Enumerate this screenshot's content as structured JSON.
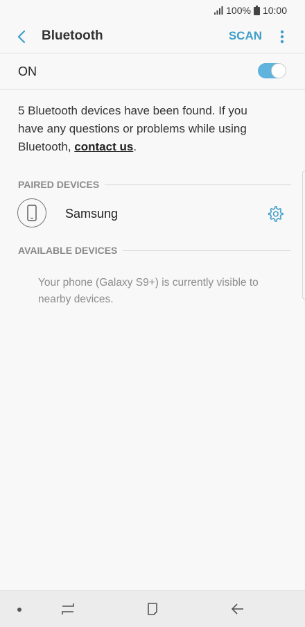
{
  "status_bar": {
    "battery_percent": "100%",
    "time": "10:00",
    "icons": [
      "signal-icon",
      "battery-icon"
    ]
  },
  "header": {
    "title": "Bluetooth",
    "scan_label": "SCAN",
    "icons": [
      "back-arrow-icon",
      "more-options-icon"
    ]
  },
  "toggle_row": {
    "label": "ON",
    "state": true
  },
  "info": {
    "text_before_link": "5 Bluetooth devices have been found. If you have any questions or problems while using Bluetooth, ",
    "link_text": "contact us",
    "text_after_link": "."
  },
  "paired_devices": {
    "header": "PAIRED DEVICES",
    "items": [
      {
        "name": "Samsung",
        "icon": "phone-icon",
        "action_icon": "gear-icon"
      }
    ]
  },
  "available_devices": {
    "header": "AVAILABLE DEVICES",
    "visibility_text": "Your phone (Galaxy S9+) is currently visible to nearby devices."
  },
  "nav_bar": {
    "icons": [
      "recent-apps-icon",
      "home-icon",
      "back-icon"
    ]
  },
  "colors": {
    "accent": "#3e9ec8",
    "toggle_on": "#5eb4dc",
    "background": "#f8f8f8"
  }
}
